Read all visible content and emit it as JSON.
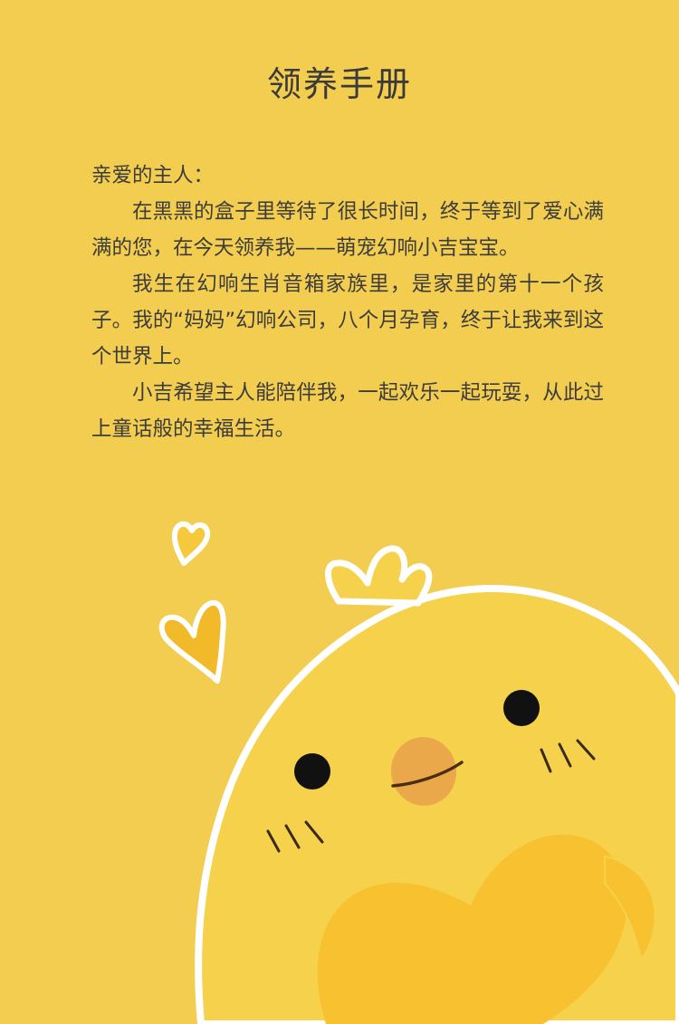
{
  "title": "领养手册",
  "letter": {
    "greeting": "亲爱的主人：",
    "paragraphs": [
      "在黑黑的盒子里等待了很长时间，终于等到了爱心满满的您，在今天领养我——萌宠幻响小吉宝宝。",
      "我生在幻响生肖音箱家族里，是家里的第十一个孩子。我的“妈妈”幻响公司，八个月孕育，终于让我来到这个世界上。",
      "小吉希望主人能陪伴我，一起欢乐一起玩耍，从此过上童话般的幸福生活。"
    ]
  },
  "illustration": {
    "subject": "chick-mascot",
    "colors": {
      "background": "#f2cd4f",
      "body": "#f6d24c",
      "outline": "#ffffff",
      "heart": "#f7c12f",
      "beak": "#eba84a",
      "eye": "#111111",
      "blush-marks": "#3a2a1a"
    }
  }
}
